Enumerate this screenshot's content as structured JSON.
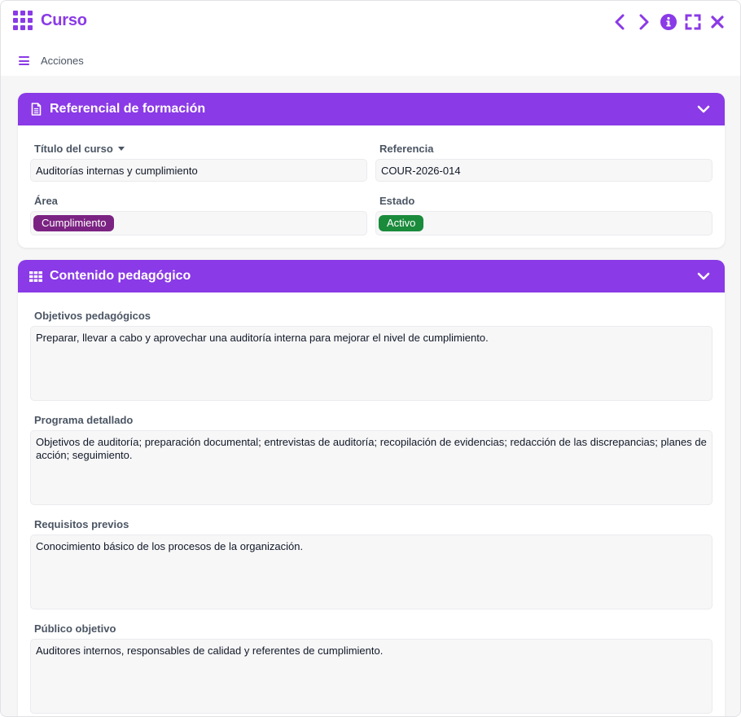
{
  "window": {
    "title": "Curso",
    "controls": [
      "chevron-left-icon",
      "chevron-right-icon",
      "info-icon",
      "fullscreen-icon",
      "close-icon"
    ],
    "accent_color": "#8a3ae6"
  },
  "toolbar": {
    "actions_label": "Acciones"
  },
  "section1": {
    "title": "Referencial de formación",
    "fields": {
      "course_title": {
        "label": "Título del curso",
        "value": "Auditorías internas y cumplimiento"
      },
      "reference": {
        "label": "Referencia",
        "value": "COUR-2026-014"
      },
      "area": {
        "label": "Área",
        "value": "Cumplimiento",
        "chip_color": "#7b2382"
      },
      "status": {
        "label": "Estado",
        "value": "Activo",
        "chip_color": "#1a8a3b"
      }
    }
  },
  "section2": {
    "title": "Contenido pedagógico",
    "fields": {
      "objectives": {
        "label": "Objetivos pedagógicos",
        "value": "Preparar, llevar a cabo y aprovechar una auditoría interna para mejorar el nivel de cumplimiento."
      },
      "program": {
        "label": "Programa detallado",
        "value": "Objetivos de auditoría; preparación documental; entrevistas de auditoría; recopilación de evidencias; redacción de las discrepancias; planes de acción; seguimiento."
      },
      "prerequisites": {
        "label": "Requisitos previos",
        "value": "Conocimiento básico de los procesos de la organización."
      },
      "audience": {
        "label": "Público objetivo",
        "value": "Auditores internos, responsables de calidad y referentes de cumplimiento."
      }
    }
  }
}
